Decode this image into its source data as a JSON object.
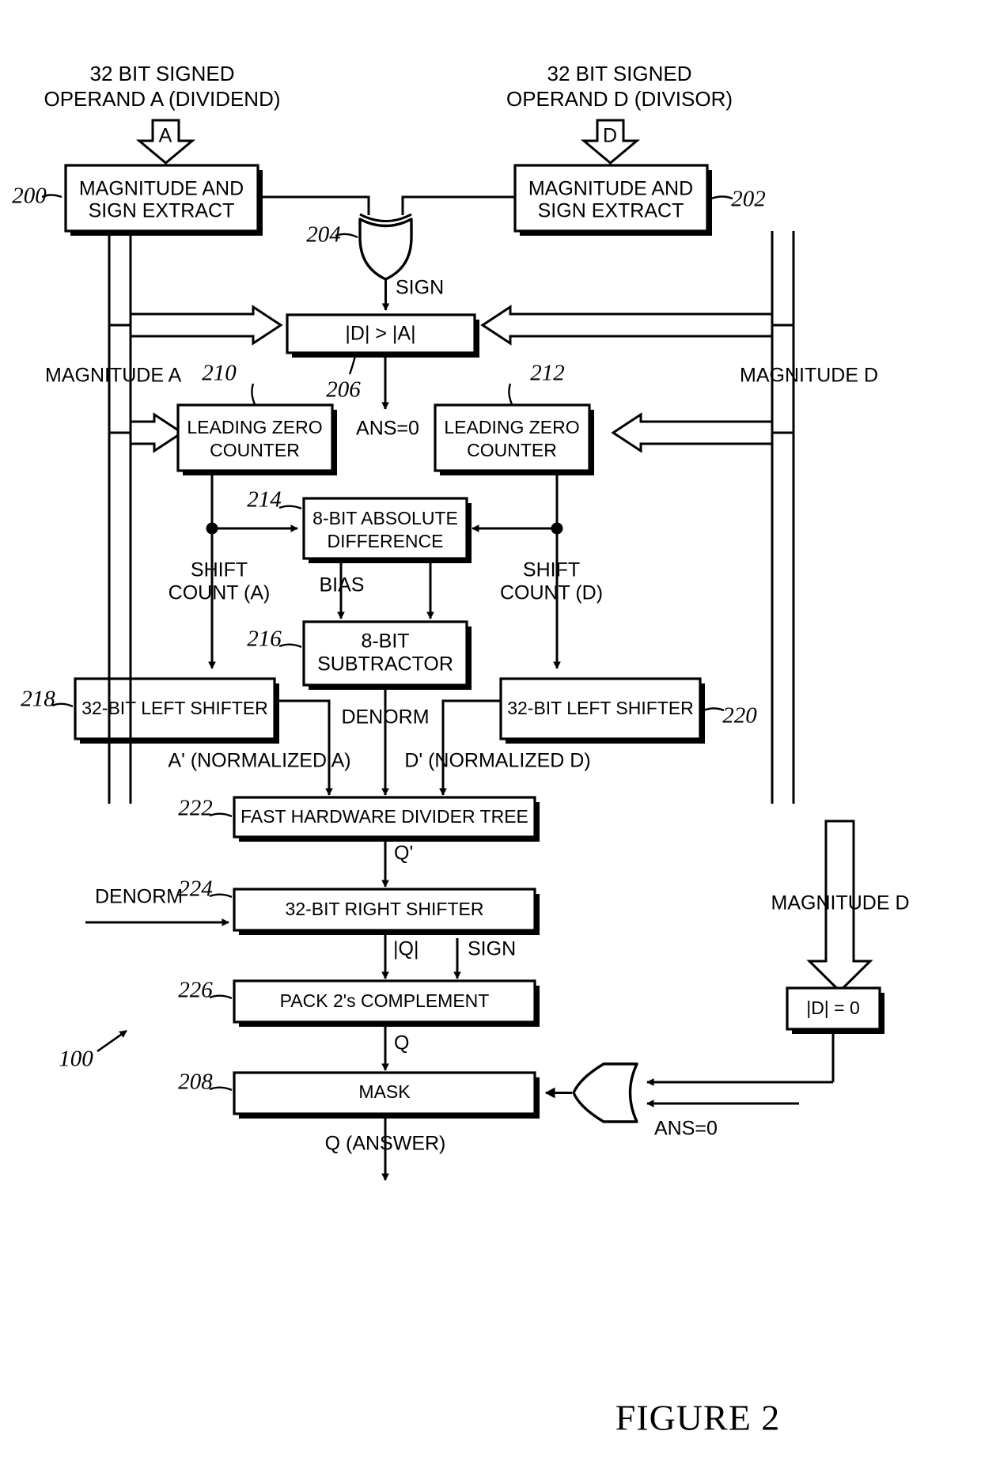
{
  "figure": {
    "caption": "FIGURE 2",
    "system_ref": "100"
  },
  "inputs": {
    "left": {
      "title_line1": "32 BIT SIGNED",
      "title_line2": "OPERAND A (DIVIDEND)",
      "arrow_label": "A"
    },
    "right": {
      "title_line1": "32 BIT SIGNED",
      "title_line2": "OPERAND D (DIVISOR)",
      "arrow_label": "D"
    }
  },
  "blocks": {
    "mag_sign_a": {
      "ref": "200",
      "line1": "MAGNITUDE AND",
      "line2": "SIGN EXTRACT"
    },
    "mag_sign_d": {
      "ref": "202",
      "line1": "MAGNITUDE AND",
      "line2": "SIGN EXTRACT"
    },
    "xor_sign": {
      "ref": "204",
      "type": "xor-gate"
    },
    "compare": {
      "ref": "206",
      "label": "|D| > |A|"
    },
    "lzc_a": {
      "ref": "210",
      "line1": "LEADING ZERO",
      "line2": "COUNTER"
    },
    "lzc_d": {
      "ref": "212",
      "line1": "LEADING ZERO",
      "line2": "COUNTER"
    },
    "abs_diff": {
      "ref": "214",
      "line1": "8-BIT ABSOLUTE",
      "line2": "DIFFERENCE"
    },
    "subtractor": {
      "ref": "216",
      "line1": "8-BIT",
      "line2": "SUBTRACTOR"
    },
    "lshift_a": {
      "ref": "218",
      "label": "32-BIT LEFT SHIFTER"
    },
    "lshift_d": {
      "ref": "220",
      "label": "32-BIT LEFT SHIFTER"
    },
    "divider": {
      "ref": "222",
      "label": "FAST HARDWARE DIVIDER TREE"
    },
    "rshift": {
      "ref": "224",
      "label": "32-BIT RIGHT SHIFTER"
    },
    "pack": {
      "ref": "226",
      "label": "PACK 2's COMPLEMENT"
    },
    "mask": {
      "ref": "208",
      "label": "MASK"
    },
    "dzero": {
      "label": "|D| = 0"
    },
    "or_gate": {
      "type": "or-gate"
    }
  },
  "signals": {
    "sign": "SIGN",
    "ans_zero_top": "ANS=0",
    "ans_zero_bottom": "ANS=0",
    "magnitude_a": "MAGNITUDE A",
    "magnitude_d": "MAGNITUDE D",
    "magnitude_d_right": "MAGNITUDE D",
    "shift_count_a_l1": "SHIFT",
    "shift_count_a_l2": "COUNT (A)",
    "shift_count_d_l1": "SHIFT",
    "shift_count_d_l2": "COUNT (D)",
    "bias": "BIAS",
    "denorm_mid": "DENORM",
    "denorm_left": "DENORM",
    "a_normalized": "A' (NORMALIZED A)",
    "d_normalized": "D' (NORMALIZED D)",
    "q_prime": "Q'",
    "q_magnitude": "|Q|",
    "sign_to_pack": "SIGN",
    "q": "Q",
    "q_answer": "Q (ANSWER)"
  }
}
